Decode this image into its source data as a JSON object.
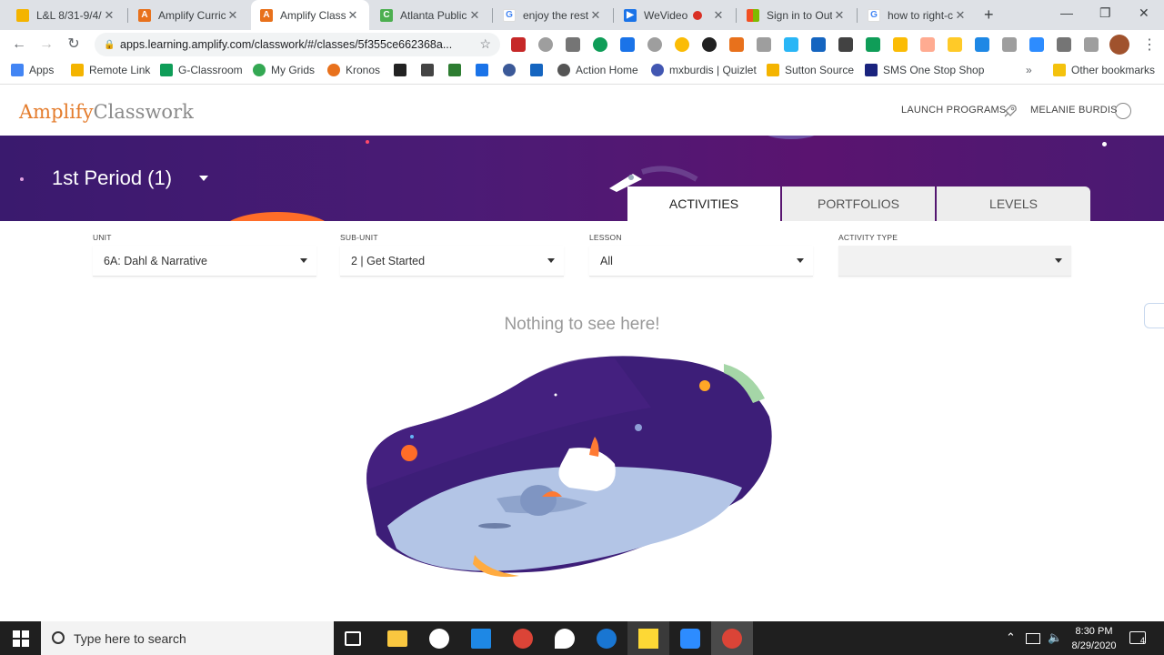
{
  "browser": {
    "tabs": [
      {
        "title": "L&L 8/31-9/4/",
        "favicon_color": "#f4b400",
        "active": false
      },
      {
        "title": "Amplify Curric",
        "favicon_color": "#e8711c",
        "active": false
      },
      {
        "title": "Amplify Classv",
        "favicon_color": "#e8711c",
        "active": true
      },
      {
        "title": "Atlanta Public",
        "favicon_color": "#4caf50",
        "active": false
      },
      {
        "title": "enjoy the rest",
        "favicon_color": "#4285f4",
        "active": false
      },
      {
        "title": "WeVideo",
        "favicon_color": "#1a73e8",
        "active": false
      },
      {
        "title": "Sign in to Outl",
        "favicon_color": "#f25022",
        "active": false
      },
      {
        "title": "how to right-c",
        "favicon_color": "#4285f4",
        "active": false
      }
    ],
    "url": "apps.learning.amplify.com/classwork/#/classes/5f355ce662368a...",
    "bookmarks": [
      {
        "label": "Apps",
        "color": "#4285f4"
      },
      {
        "label": "Remote Link",
        "color": "#f4b400"
      },
      {
        "label": "G-Classroom",
        "color": "#0f9d58"
      },
      {
        "label": "My Grids",
        "color": "#34a853"
      },
      {
        "label": "Kronos",
        "color": "#e8711c"
      },
      {
        "label": "",
        "color": "#222222"
      },
      {
        "label": "",
        "color": "#444444"
      },
      {
        "label": "",
        "color": "#2e7d32"
      },
      {
        "label": "",
        "color": "#1a73e8"
      },
      {
        "label": "",
        "color": "#3b5998"
      },
      {
        "label": "",
        "color": "#1565c0"
      },
      {
        "label": "Action Home",
        "color": "#555555"
      },
      {
        "label": "mxburdis | Quizlet",
        "color": "#4257b2"
      },
      {
        "label": "Sutton Source",
        "color": "#f4b400"
      },
      {
        "label": "SMS One Stop Shop",
        "color": "#1a237e"
      },
      {
        "label": "Other bookmarks",
        "color": "#f4c20d"
      }
    ]
  },
  "app": {
    "logo_part1": "Amplify",
    "logo_part2": "Classwork",
    "launch_programs": "LAUNCH PROGRAMS",
    "user_name": "MELANIE BURDIS",
    "class_title": "1st Period (1)",
    "tabs": {
      "activities": "ACTIVITIES",
      "portfolios": "PORTFOLIOS",
      "levels": "LEVELS"
    },
    "filters": {
      "unit": {
        "label": "UNIT",
        "value": "6A: Dahl & Narrative"
      },
      "subunit": {
        "label": "SUB-UNIT",
        "value": "2 | Get Started"
      },
      "lesson": {
        "label": "LESSON",
        "value": "All"
      },
      "activity_type": {
        "label": "ACTIVITY TYPE",
        "value": ""
      }
    },
    "empty_message": "Nothing to see here!"
  },
  "taskbar": {
    "search_placeholder": "Type here to search",
    "time": "8:30 PM",
    "date": "8/29/2020",
    "notification_count": "4"
  },
  "colors": {
    "brand_orange": "#e47c2c",
    "banner_purple": "#4b1b75"
  }
}
